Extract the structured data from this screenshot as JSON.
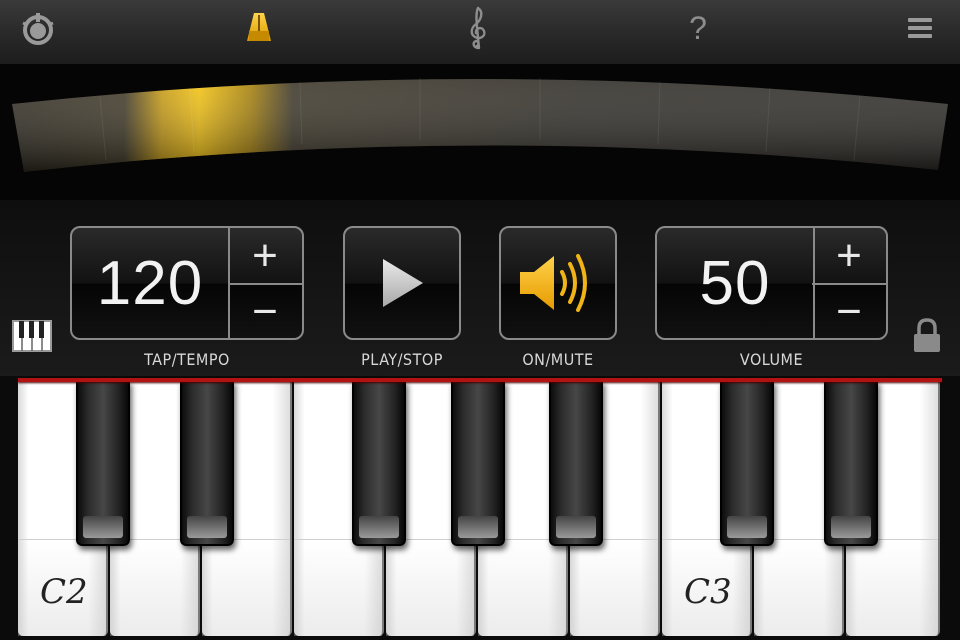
{
  "topbar": {
    "icons": [
      "tuner-icon",
      "metronome-icon",
      "treble-clef-icon",
      "help-icon",
      "menu-icon"
    ],
    "help_glyph": "?",
    "accent": "#f3b820"
  },
  "pendulum": {
    "position": 0.2,
    "highlight_color": "#e8b010"
  },
  "controls": {
    "tempo": {
      "value": "120",
      "plus": "+",
      "minus": "−",
      "label": "TAP/TEMPO"
    },
    "play": {
      "label": "PLAY/STOP"
    },
    "mute": {
      "label": "ON/MUTE"
    },
    "volume": {
      "value": "50",
      "plus": "+",
      "minus": "−",
      "label": "VOLUME"
    }
  },
  "keyboard": {
    "white_keys": 10,
    "note_labels": [
      {
        "text": "C2"
      },
      {
        "text": "C3"
      }
    ],
    "marker_color": "#b31212"
  }
}
